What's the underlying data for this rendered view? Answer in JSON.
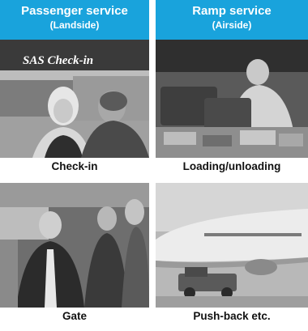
{
  "colors": {
    "accent": "#19a3dc"
  },
  "columns": [
    {
      "title": "Passenger service",
      "subtitle": "(Landside)",
      "panels": [
        {
          "caption": "Check-in",
          "sign": "SAS Check-in",
          "image": "check-in-counter-photo"
        },
        {
          "caption": "Gate",
          "image": "gate-staff-photo"
        }
      ]
    },
    {
      "title": "Ramp service",
      "subtitle": "(Airside)",
      "panels": [
        {
          "caption": "Loading/unloading",
          "image": "baggage-loading-photo"
        },
        {
          "caption": "Push-back etc.",
          "image": "aircraft-pushback-photo"
        }
      ]
    }
  ]
}
